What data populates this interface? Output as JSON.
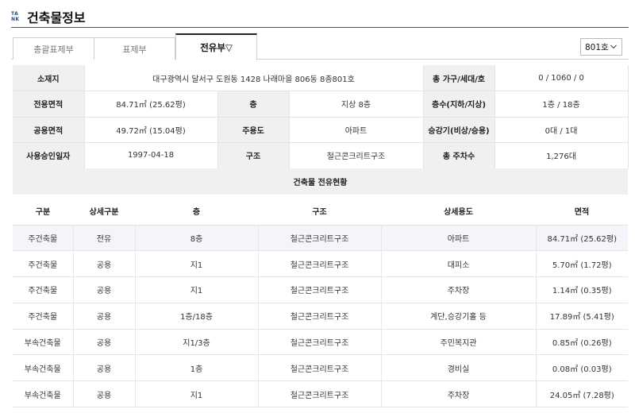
{
  "header": {
    "logo_top": "TA",
    "logo_bottom": "NK",
    "title": "건축물정보"
  },
  "tabs": [
    {
      "label": "총괄표제부",
      "active": false
    },
    {
      "label": "표제부",
      "active": false
    },
    {
      "label": "전유부▽",
      "active": true
    }
  ],
  "unit_select": {
    "value": "801호"
  },
  "info": {
    "address_label": "소재지",
    "address_value": "대구광역시 달서구 도원동 1428 나래마을 806동 8층801호",
    "households_label": "총 가구/세대/호",
    "households_value": "0 / 1060 / 0",
    "exclusive_area_label": "전용면적",
    "exclusive_area_value": "84.71㎡ (25.62평)",
    "floor_label": "층",
    "floor_value": "지상 8층",
    "stories_label": "층수(지하/지상)",
    "stories_value": "1층 / 18층",
    "common_area_label": "공용면적",
    "common_area_value": "49.72㎡ (15.04평)",
    "main_use_label": "주용도",
    "main_use_value": "아파트",
    "elevator_label": "승강기(비상/승용)",
    "elevator_value": "0대 / 1대",
    "approval_date_label": "사용승인일자",
    "approval_date_value": "1997-04-18",
    "structure_label": "구조",
    "structure_value": "철근콘크리트구조",
    "parking_label": "총 주차수",
    "parking_value": "1,276대"
  },
  "section_title": "건축물 전유현황",
  "units_table": {
    "columns": [
      "구분",
      "상세구분",
      "층",
      "구조",
      "상세용도",
      "면적"
    ],
    "rows": [
      [
        "주건축물",
        "전유",
        "8층",
        "철근콘크리트구조",
        "아파트",
        "84.71㎡ (25.62평)"
      ],
      [
        "주건축물",
        "공용",
        "지1",
        "철근콘크리트구조",
        "대피소",
        "5.70㎡ (1.72평)"
      ],
      [
        "주건축물",
        "공용",
        "지1",
        "철근콘크리트구조",
        "주차장",
        "1.14㎡ (0.35평)"
      ],
      [
        "주건축물",
        "공용",
        "1층/18층",
        "철근콘크리트구조",
        "계단,승강기홀 등",
        "17.89㎡ (5.41평)"
      ],
      [
        "부속건축물",
        "공용",
        "지1/3층",
        "철근콘크리트구조",
        "주민복지관",
        "0.85㎡ (0.26평)"
      ],
      [
        "부속건축물",
        "공용",
        "1층",
        "철근콘크리트구조",
        "경비실",
        "0.08㎡ (0.03평)"
      ],
      [
        "부속건축물",
        "공용",
        "지1",
        "철근콘크리트구조",
        "주차장",
        "24.05㎡ (7.28평)"
      ]
    ]
  }
}
